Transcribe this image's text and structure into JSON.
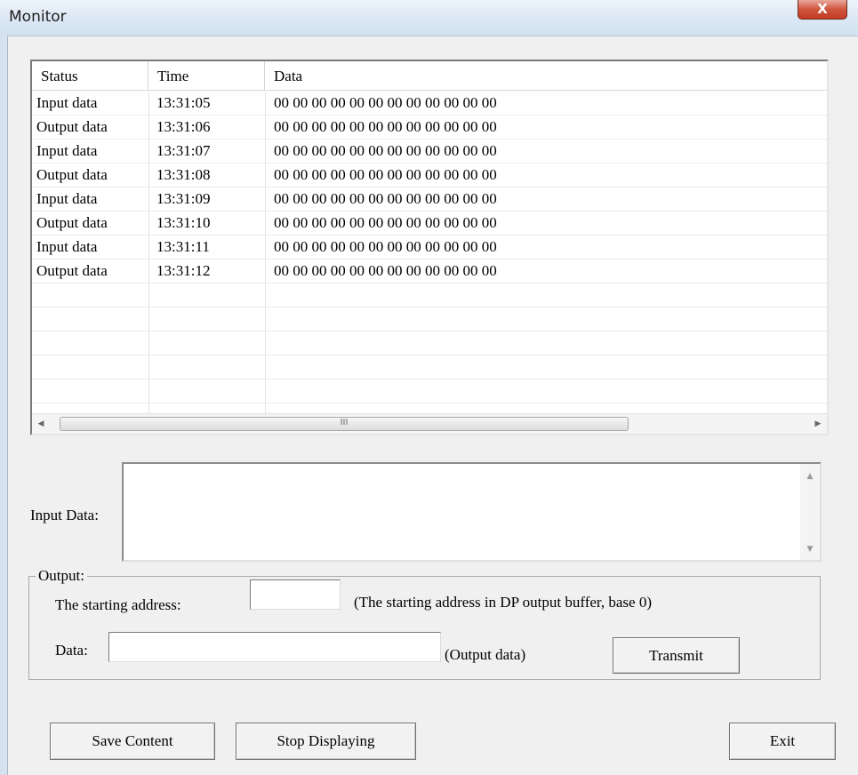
{
  "window": {
    "title": "Monitor",
    "close_label": "X"
  },
  "list": {
    "columns": [
      "Status",
      "Time",
      "Data"
    ],
    "rows": [
      {
        "status": "Input data",
        "time": "13:31:05",
        "data": "00 00 00 00 00 00 00 00 00 00 00 00"
      },
      {
        "status": "Output data",
        "time": "13:31:06",
        "data": "00 00 00 00 00 00 00 00 00 00 00 00"
      },
      {
        "status": "Input data",
        "time": "13:31:07",
        "data": "00 00 00 00 00 00 00 00 00 00 00 00"
      },
      {
        "status": "Output data",
        "time": "13:31:08",
        "data": "00 00 00 00 00 00 00 00 00 00 00 00"
      },
      {
        "status": "Input data",
        "time": "13:31:09",
        "data": "00 00 00 00 00 00 00 00 00 00 00 00"
      },
      {
        "status": "Output data",
        "time": "13:31:10",
        "data": "00 00 00 00 00 00 00 00 00 00 00 00"
      },
      {
        "status": "Input data",
        "time": "13:31:11",
        "data": "00 00 00 00 00 00 00 00 00 00 00 00"
      },
      {
        "status": "Output data",
        "time": "13:31:12",
        "data": "00 00 00 00 00 00 00 00 00 00 00 00"
      }
    ],
    "empty_rows": 6,
    "scroll_thumb_label": "III"
  },
  "input_data": {
    "label": "Input Data:",
    "value": ""
  },
  "output": {
    "group_label": "Output:",
    "start_address_label": "The starting address:",
    "start_address_value": "",
    "start_address_hint": "(The starting address in DP output buffer, base 0)",
    "data_label": "Data:",
    "data_value": "",
    "data_hint": "(Output data)",
    "transmit_label": "Transmit"
  },
  "footer": {
    "save_label": "Save Content",
    "stop_label": "Stop Displaying",
    "exit_label": "Exit"
  },
  "icons": {
    "scroll_left": "◀",
    "scroll_right": "▶",
    "scroll_up": "▲",
    "scroll_down": "▼"
  }
}
